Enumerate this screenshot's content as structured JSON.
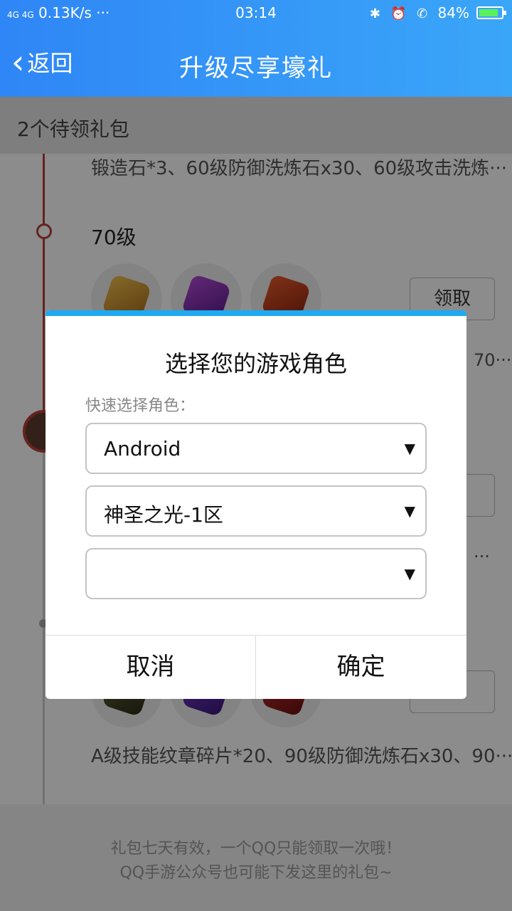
{
  "status_bar": {
    "network": "4G 4G",
    "speed": "0.13K/s",
    "dots": "···",
    "time": "03:14",
    "right_text": "84%"
  },
  "nav": {
    "back_label": "返回",
    "title": "升级尽享壕礼"
  },
  "subheader": {
    "text": "2个待领礼包"
  },
  "background_list": {
    "row1_text": "锻造石*3、60级防御洗炼石x30、60级攻击洗炼···",
    "level_label": "70级",
    "claim_label": "领取",
    "side_text_1": "70···",
    "side_text_2": "···",
    "row3_text": "A级技能纹章碎片*20、90级防御洗炼石x30、90···"
  },
  "footer": {
    "line1": "礼包七天有效，一个QQ只能领取一次哦！",
    "line2": "QQ手游公众号也可能下发这里的礼包~"
  },
  "dialog": {
    "title": "选择您的游戏角色",
    "label": "快速选择角色：",
    "select_platform": "Android",
    "select_server": "神圣之光-1区",
    "select_role": "",
    "cancel_label": "取消",
    "confirm_label": "确定"
  },
  "colors": {
    "accent": "#1fa9f0",
    "nav_gradient_start": "#2f86f6",
    "timeline": "#b9413a"
  }
}
